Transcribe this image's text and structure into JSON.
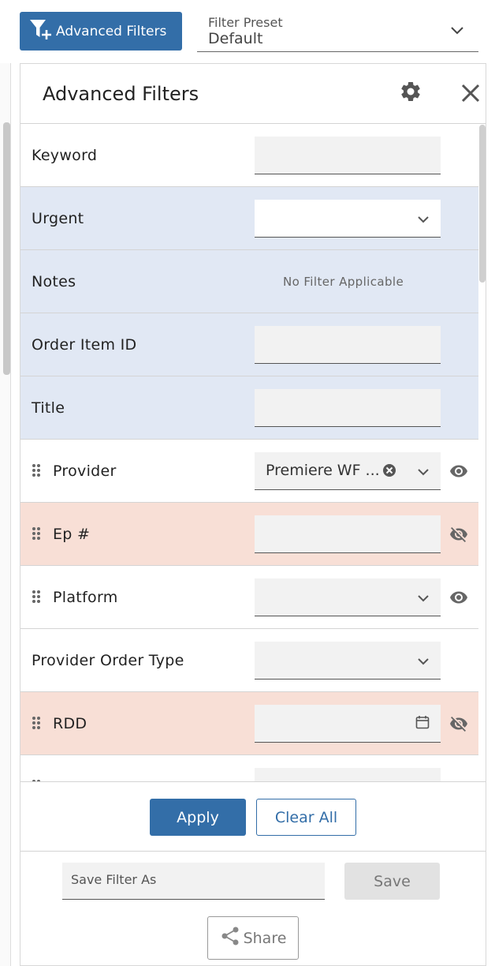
{
  "toolbar": {
    "advanced_filters_label": "Advanced Filters",
    "preset_label": "Filter Preset",
    "preset_value": "Default"
  },
  "panel": {
    "title": "Advanced Filters"
  },
  "rows": {
    "keyword": {
      "label": "Keyword",
      "value": ""
    },
    "urgent": {
      "label": "Urgent",
      "value": ""
    },
    "notes": {
      "label": "Notes",
      "note": "No Filter Applicable"
    },
    "order_item_id": {
      "label": "Order Item ID",
      "value": ""
    },
    "title": {
      "label": "Title",
      "value": ""
    },
    "provider": {
      "label": "Provider",
      "value": "Premiere WF ..."
    },
    "ep": {
      "label": "Ep #",
      "value": ""
    },
    "platform": {
      "label": "Platform",
      "value": ""
    },
    "provider_order_type": {
      "label": "Provider Order Type",
      "value": ""
    },
    "rdd": {
      "label": "RDD",
      "value": ""
    }
  },
  "actions": {
    "apply_label": "Apply",
    "clear_all_label": "Clear All"
  },
  "save": {
    "placeholder": "Save Filter As",
    "save_label": "Save",
    "share_label": "Share"
  },
  "colors": {
    "primary": "#336ea8",
    "row_blue": "#e1e8f4",
    "row_pink": "#f8dfd6"
  }
}
